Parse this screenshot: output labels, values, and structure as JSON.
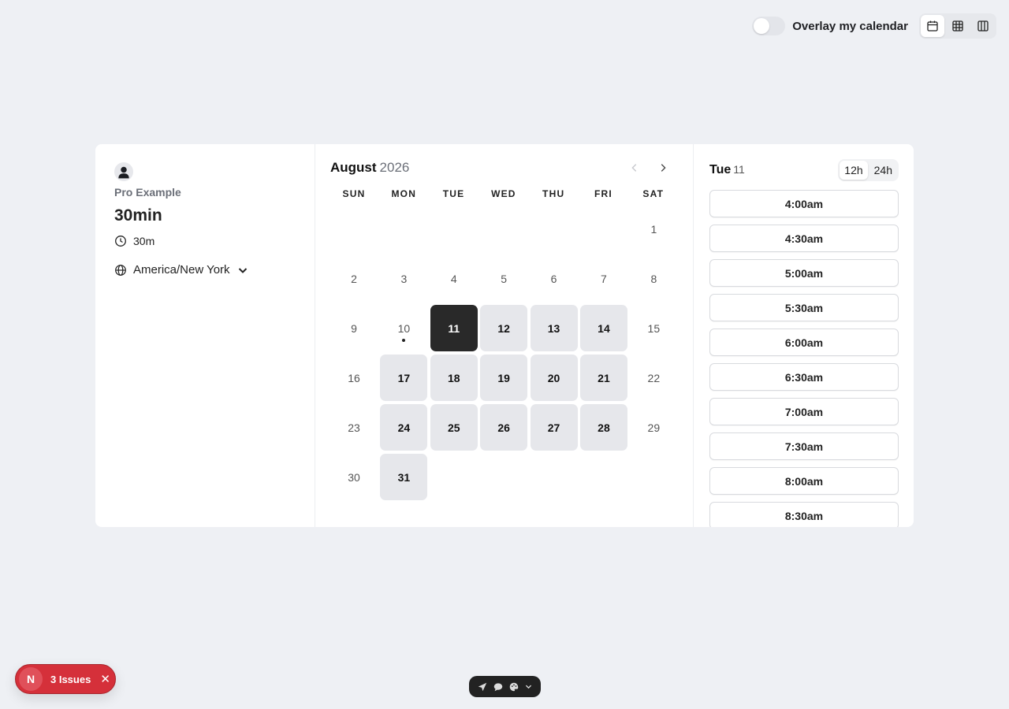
{
  "topbar": {
    "overlay_label": "Overlay my calendar",
    "overlay_on": false,
    "views": [
      {
        "icon": "calendar-month-icon",
        "active": true
      },
      {
        "icon": "grid-week-icon",
        "active": false
      },
      {
        "icon": "columns-icon",
        "active": false
      }
    ]
  },
  "profile": {
    "name": "Pro Example",
    "event_title": "30min",
    "duration": "30m",
    "timezone": "America/New York"
  },
  "calendar": {
    "month": "August",
    "year": "2026",
    "weekdays": [
      "SUN",
      "MON",
      "TUE",
      "WED",
      "THU",
      "FRI",
      "SAT"
    ],
    "days": [
      {
        "label": "",
        "state": "empty"
      },
      {
        "label": "",
        "state": "empty"
      },
      {
        "label": "",
        "state": "empty"
      },
      {
        "label": "",
        "state": "empty"
      },
      {
        "label": "",
        "state": "empty"
      },
      {
        "label": "",
        "state": "empty"
      },
      {
        "label": "1",
        "state": "disabled"
      },
      {
        "label": "2",
        "state": "disabled"
      },
      {
        "label": "3",
        "state": "disabled"
      },
      {
        "label": "4",
        "state": "disabled"
      },
      {
        "label": "5",
        "state": "disabled"
      },
      {
        "label": "6",
        "state": "disabled"
      },
      {
        "label": "7",
        "state": "disabled"
      },
      {
        "label": "8",
        "state": "disabled"
      },
      {
        "label": "9",
        "state": "disabled"
      },
      {
        "label": "10",
        "state": "today"
      },
      {
        "label": "11",
        "state": "selected"
      },
      {
        "label": "12",
        "state": "available"
      },
      {
        "label": "13",
        "state": "available"
      },
      {
        "label": "14",
        "state": "available"
      },
      {
        "label": "15",
        "state": "disabled"
      },
      {
        "label": "16",
        "state": "disabled"
      },
      {
        "label": "17",
        "state": "available"
      },
      {
        "label": "18",
        "state": "available"
      },
      {
        "label": "19",
        "state": "available"
      },
      {
        "label": "20",
        "state": "available"
      },
      {
        "label": "21",
        "state": "available"
      },
      {
        "label": "22",
        "state": "disabled"
      },
      {
        "label": "23",
        "state": "disabled"
      },
      {
        "label": "24",
        "state": "available"
      },
      {
        "label": "25",
        "state": "available"
      },
      {
        "label": "26",
        "state": "available"
      },
      {
        "label": "27",
        "state": "available"
      },
      {
        "label": "28",
        "state": "available"
      },
      {
        "label": "29",
        "state": "disabled"
      },
      {
        "label": "30",
        "state": "disabled"
      },
      {
        "label": "31",
        "state": "available"
      }
    ]
  },
  "slots": {
    "day": "Tue",
    "date": "11",
    "formats": [
      {
        "label": "12h",
        "active": true
      },
      {
        "label": "24h",
        "active": false
      }
    ],
    "times": [
      "4:00am",
      "4:30am",
      "5:00am",
      "5:30am",
      "6:00am",
      "6:30am",
      "7:00am",
      "7:30am",
      "8:00am",
      "8:30am"
    ]
  },
  "issues": {
    "badge": "N",
    "label": "3 Issues"
  },
  "colors": {
    "background": "#eef0f4",
    "selected_day": "#292929",
    "available_day": "#e6e7eb",
    "issues_red": "#d5303a"
  }
}
